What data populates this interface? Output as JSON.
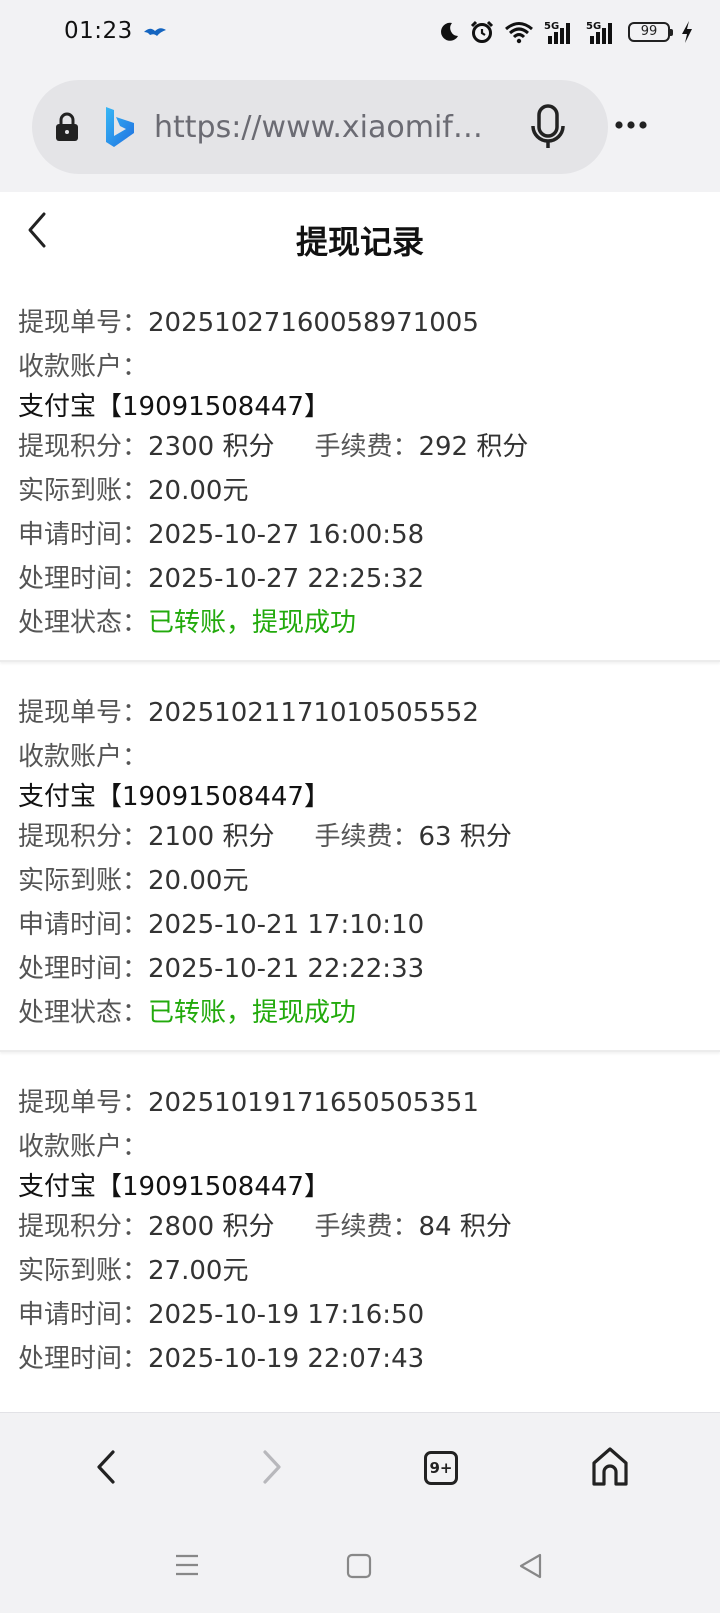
{
  "status_bar": {
    "time": "01:23",
    "battery": "99",
    "icons": [
      "moon-icon",
      "alarm-icon",
      "wifi-icon",
      "signal-5g-icon",
      "signal-5g-icon",
      "battery-icon",
      "charging-icon"
    ]
  },
  "browser": {
    "url": "https://www.xiaomifen...",
    "tabs_count": "9+"
  },
  "page": {
    "title": "提现记录"
  },
  "labels": {
    "order_no": "提现单号：",
    "account": "收款账户：",
    "points": "提现积分：",
    "fee": "手续费：",
    "actual": "实际到账：",
    "apply_time": "申请时间：",
    "process_time": "处理时间：",
    "status": "处理状态："
  },
  "records": [
    {
      "order_no": "20251027160058971005",
      "account": "支付宝【19091508447】",
      "points": "2300 积分",
      "fee": "292 积分",
      "actual": "20.00元",
      "apply_time": "2025-10-27 16:00:58",
      "process_time": "2025-10-27 22:25:32",
      "status": "已转账，提现成功"
    },
    {
      "order_no": "20251021171010505552",
      "account": "支付宝【19091508447】",
      "points": "2100 积分",
      "fee": "63 积分",
      "actual": "20.00元",
      "apply_time": "2025-10-21 17:10:10",
      "process_time": "2025-10-21 22:22:33",
      "status": "已转账，提现成功"
    },
    {
      "order_no": "20251019171650505351",
      "account": "支付宝【19091508447】",
      "points": "2800 积分",
      "fee": "84 积分",
      "actual": "27.00元",
      "apply_time": "2025-10-19 17:16:50",
      "process_time": "2025-10-19 22:07:43",
      "status": ""
    }
  ],
  "colors": {
    "success": "#22aa0c",
    "background": "#f2f2f4"
  }
}
